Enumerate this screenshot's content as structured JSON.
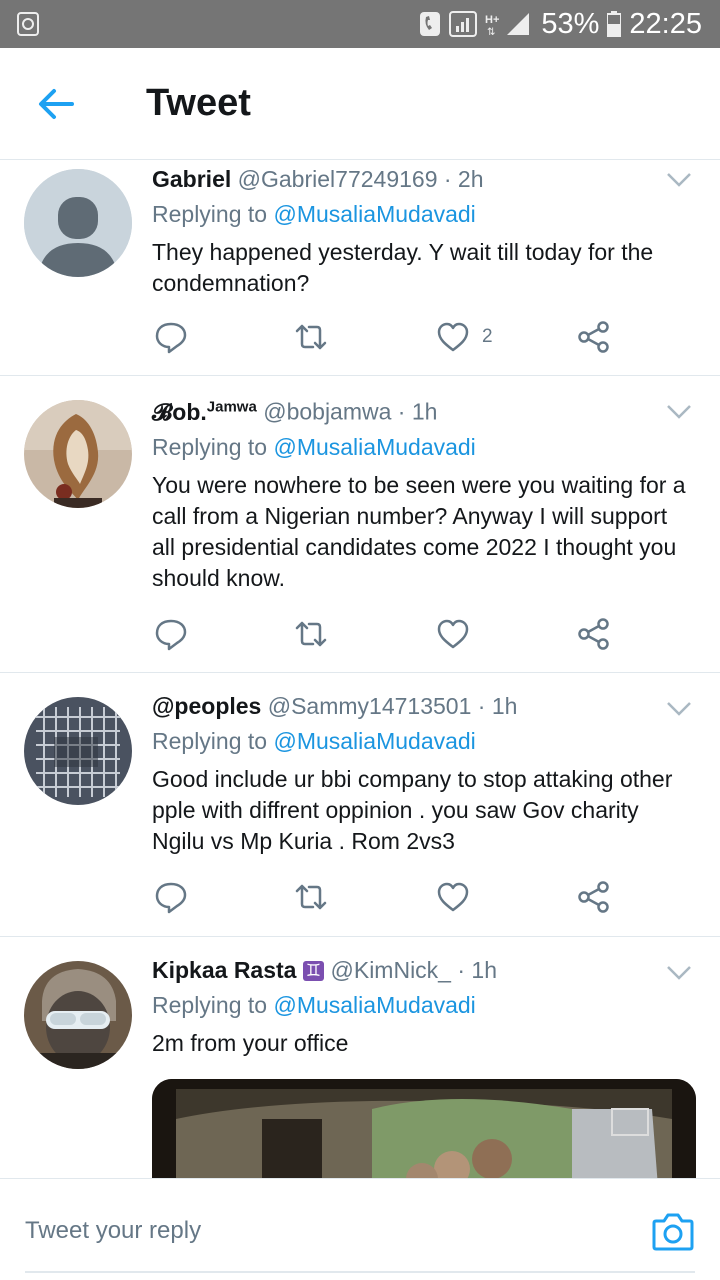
{
  "status_bar": {
    "battery": "53%",
    "time": "22:25"
  },
  "header": {
    "title": "Tweet"
  },
  "tweets": [
    {
      "name": "Gabriel",
      "name_sup": "",
      "handle": "@Gabriel77249169",
      "time": "· 2h",
      "replying_prefix": "Replying to",
      "replying_to": "@MusaliaMudavadi",
      "text": "They happened yesterday. Y wait till today for the condemnation?",
      "likes": "2"
    },
    {
      "name": "𝓑ob.",
      "name_sup": "Jamwa",
      "handle": "@bobjamwa",
      "time": "· 1h",
      "replying_prefix": "Replying to",
      "replying_to": "@MusaliaMudavadi",
      "text": "You were nowhere to be seen were you waiting for a call from a Nigerian number? Anyway I will support all presidential candidates come 2022 I thought you should know.",
      "likes": ""
    },
    {
      "name": "@peoples",
      "name_sup": "",
      "handle": "@Sammy14713501",
      "time": "· 1h",
      "replying_prefix": "Replying to",
      "replying_to": "@MusaliaMudavadi",
      "text": "Good include ur bbi company to stop attaking other pple with diffrent oppinion . you saw Gov charity Ngilu vs Mp Kuria . Rom 2vs3",
      "likes": ""
    },
    {
      "name": "Kipkaa Rasta",
      "name_sup": "",
      "badge": "♊",
      "handle": "@KimNick_",
      "time": "· 1h",
      "replying_prefix": "Replying to",
      "replying_to": "@MusaliaMudavadi",
      "text": "2m from your office",
      "likes": ""
    }
  ],
  "reply_bar": {
    "placeholder": "Tweet your reply"
  },
  "icons": {
    "back": "arrow-left-icon",
    "caret": "chevron-down-icon",
    "reply": "comment-icon",
    "retweet": "retweet-icon",
    "like": "heart-icon",
    "share": "share-icon",
    "camera": "camera-icon"
  },
  "colors": {
    "accent": "#1da1f2",
    "mention": "#1b95e0",
    "secondary_text": "#657786",
    "status_bar": "#757575"
  }
}
